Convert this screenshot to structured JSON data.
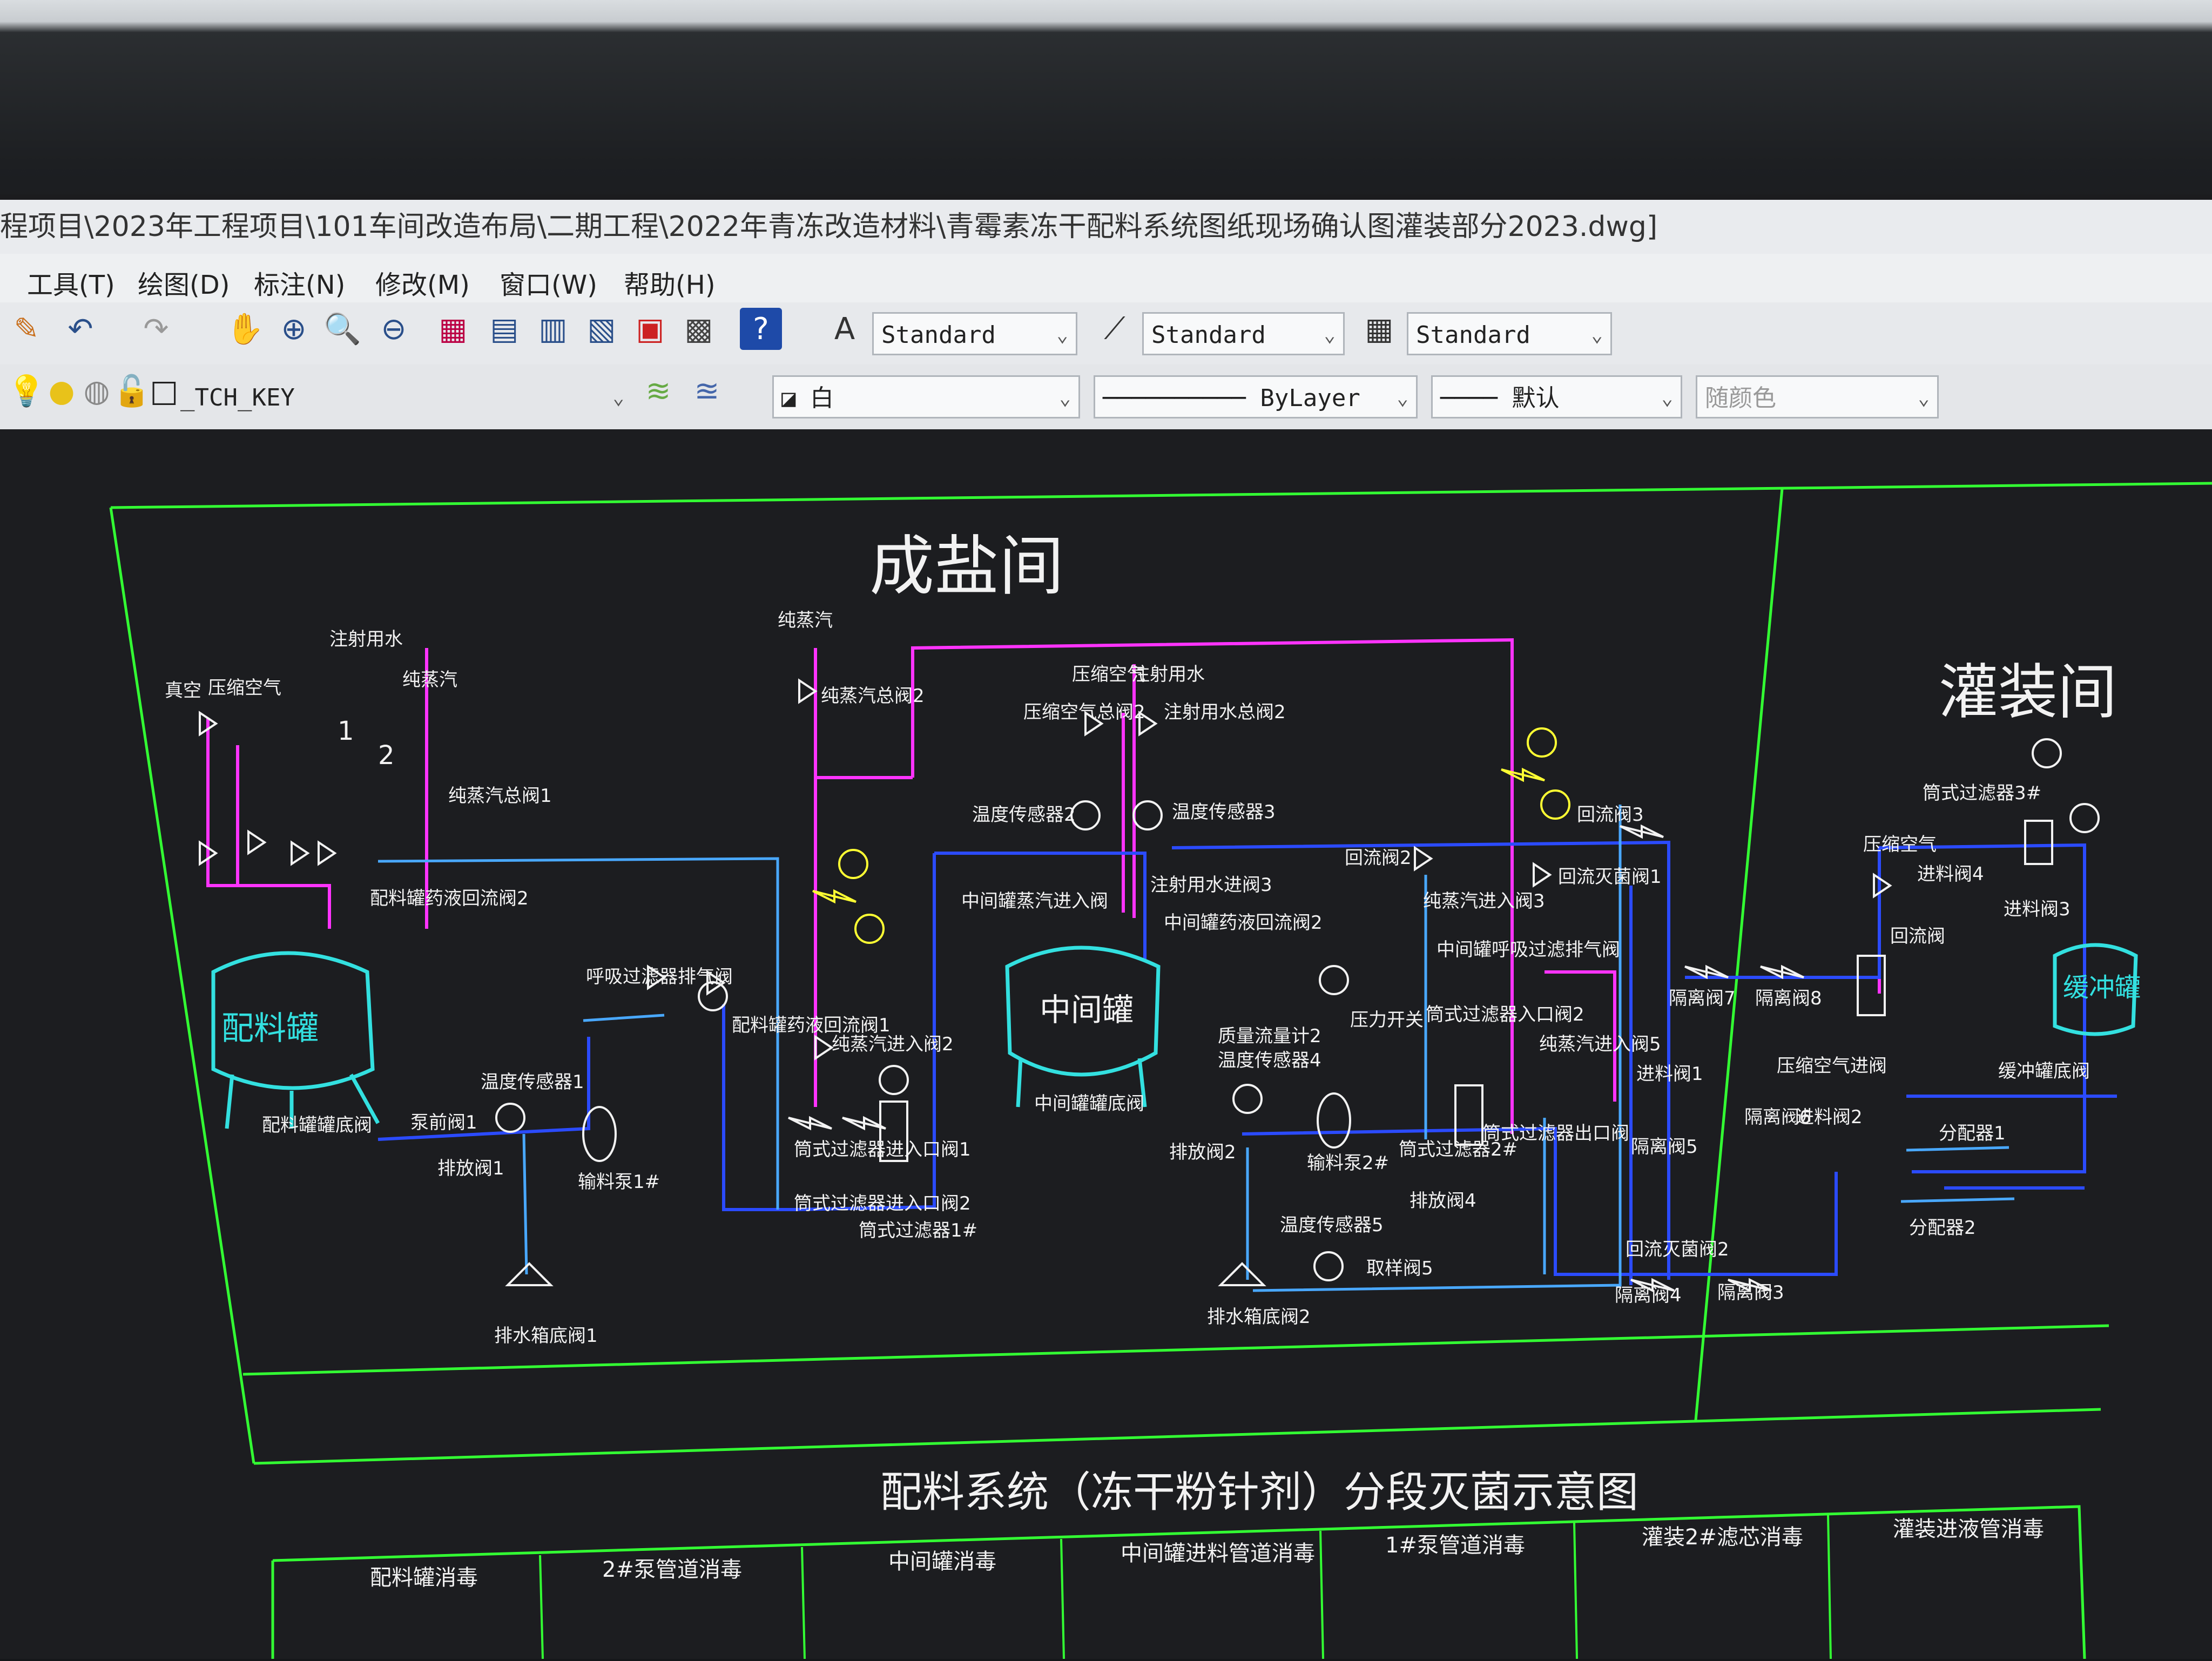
{
  "window": {
    "title": "程项目\\2023年工程项目\\101车间改造布局\\二期工程\\2022年青冻改造材料\\青霉素冻干配料系统图纸现场确认图灌装部分2023.dwg]"
  },
  "menu": {
    "items": [
      "工具(T)",
      "绘图(D)",
      "标注(N)",
      "修改(M)",
      "窗口(W)",
      "帮助(H)"
    ]
  },
  "toolbar": {
    "text_style": "Standard",
    "dim_style": "Standard",
    "table_style": "Standard"
  },
  "layers": {
    "current_layer": "_TCH_KEY",
    "color": "白",
    "linetype": "ByLayer",
    "lineweight": "默认",
    "plot_color": "随颜色"
  },
  "drawing": {
    "sections": {
      "salt_room": "成盐间",
      "filling_room": "灌装间"
    },
    "vessels": {
      "batch_tank": "配料罐",
      "middle_tank": "中间罐",
      "buffer_tank": "缓冲罐"
    },
    "labels": {
      "vacuum": "真空",
      "compressed_air": "压缩空气",
      "inject_water": "注射用水",
      "pure_steam": "纯蒸汽",
      "inlet_valve_1": "1",
      "inlet_valve_2": "2",
      "pure_steam_main_1": "纯蒸汽总阀1",
      "pure_steam_main_2": "纯蒸汽总阀2",
      "batch_tank_return": "配料罐药液回流阀2",
      "batch_tank_bottom": "配料罐罐底阀",
      "temp_sensor_1": "温度传感器1",
      "pump_valve_1": "泵前阀1",
      "drain_valve_1": "排放阀1",
      "pump_1": "输料泵1#",
      "drain_1": "排水箱底阀1",
      "breather_valve": "呼吸过滤器排气阀",
      "batch_return_valve": "配料罐药液回流阀1",
      "filter_1": "筒式过滤器1#",
      "pure_steam_in_2": "纯蒸汽进入阀2",
      "cap_filter_in_1": "筒式过滤器进入口阀1",
      "cap_filter_in_2": "筒式过滤器进入口阀2",
      "air_total_2": "压缩空气总阀2",
      "water_total_2": "注射用水总阀2",
      "compressed_air_top": "压缩空气",
      "inject_water_top": "注射用水",
      "temp_sensor_2": "温度传感器2",
      "temp_sensor_3": "温度传感器3",
      "middle_steam_in": "中间罐蒸汽进入阀",
      "inject_water_in_3": "注射用水进阀3",
      "middle_return_2": "中间罐药液回流阀2",
      "middle_bottom": "中间罐罐底阀",
      "return_valve_2": "回流阀2",
      "return_valve_3": "回流阀3",
      "return_total_1": "回流灭菌阀1",
      "steam_in_3": "纯蒸汽进入阀3",
      "breather_2": "中间罐呼吸过滤排气阀",
      "pressure_switch": "压力开关",
      "cap_filter_2": "筒式过滤器入口阀2",
      "quality_flow_2": "质量流量计2",
      "temp_sensor_4": "温度传感器4",
      "pump_2": "输料泵2#",
      "drain_valve_2": "排放阀2",
      "drain_2": "排水箱底阀2",
      "temp_sensor_5": "温度传感器5",
      "exhaust_5": "取样阀5",
      "filter_2": "筒式过滤器2#",
      "drain_4": "排放阀4",
      "pure_steam_in_5": "纯蒸汽进入阀5",
      "cap_filter_out": "筒式过滤器出口阀",
      "inlet_1": "进料阀1",
      "isolate_7": "隔离阀7",
      "isolate_8": "隔离阀8",
      "isolate_5": "隔离阀5",
      "isolate_6": "隔离阀6",
      "isolate_4": "隔离阀4",
      "isolate_3": "隔离阀3",
      "return_total_2": "回流灭菌阀2",
      "feed_2": "进料阀2",
      "feed_3": "进料阀3",
      "feed_4": "进料阀4",
      "filter_3": "筒式过滤器3#",
      "compressed_air_fill": "压缩空气",
      "air_in_valve": "压缩空气进阀",
      "return_valve_fill": "回流阀",
      "buffer_bottom": "缓冲罐底阀",
      "distributor_1": "分配器1",
      "distributor_2": "分配器2"
    },
    "subtitle": "配料系统（冻干粉针剂）分段灭菌示意图",
    "cells": [
      "配料罐消毒",
      "2#泵管道消毒",
      "中间罐消毒",
      "中间罐进料管道消毒",
      "1#泵管道消毒",
      "灌装2#滤芯消毒",
      "灌装进液管消毒"
    ],
    "colors": {
      "frame": "#33ff33",
      "pipe_blue": "#2b4bff",
      "pipe_light": "#49a8ff",
      "magenta": "#ff33ff",
      "vessel": "#33e0e0",
      "yellow": "#ffff33",
      "white": "#f2f2f2"
    }
  }
}
